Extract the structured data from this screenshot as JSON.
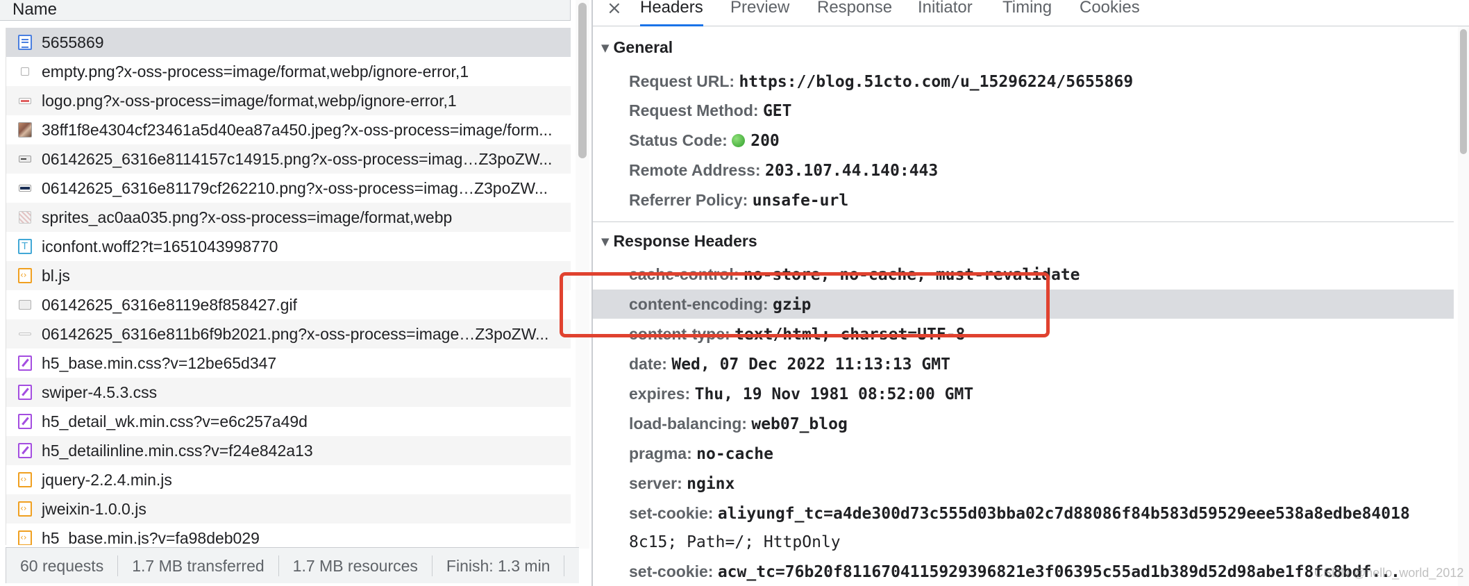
{
  "request_list": {
    "column_header": "Name",
    "rows": [
      {
        "name": "5655869",
        "icon": "document-icon"
      },
      {
        "name": "empty.png?x-oss-process=image/format,webp/ignore-error,1",
        "icon": "image-icon"
      },
      {
        "name": "logo.png?x-oss-process=image/format,webp/ignore-error,1",
        "icon": "image-icon"
      },
      {
        "name": "38ff1f8e4304cf23461a5d40ea87a450.jpeg?x-oss-process=image/form...",
        "icon": "image-icon"
      },
      {
        "name": "06142625_6316e8114157c14915.png?x-oss-process=imag…Z3poZW...",
        "icon": "image-icon"
      },
      {
        "name": "06142625_6316e81179cf262210.png?x-oss-process=imag…Z3poZW...",
        "icon": "image-icon"
      },
      {
        "name": "sprites_ac0aa035.png?x-oss-process=image/format,webp",
        "icon": "image-icon"
      },
      {
        "name": "iconfont.woff2?t=1651043998770",
        "icon": "font-icon"
      },
      {
        "name": "bl.js",
        "icon": "script-icon"
      },
      {
        "name": "06142625_6316e8119e8f858427.gif",
        "icon": "image-icon"
      },
      {
        "name": "06142625_6316e811b6f9b2021.png?x-oss-process=image…Z3poZW...",
        "icon": "image-icon"
      },
      {
        "name": "h5_base.min.css?v=12be65d347",
        "icon": "stylesheet-icon"
      },
      {
        "name": "swiper-4.5.3.css",
        "icon": "stylesheet-icon"
      },
      {
        "name": "h5_detail_wk.min.css?v=e6c257a49d",
        "icon": "stylesheet-icon"
      },
      {
        "name": "h5_detailinline.min.css?v=f24e842a13",
        "icon": "stylesheet-icon"
      },
      {
        "name": "jquery-2.2.4.min.js",
        "icon": "script-icon"
      },
      {
        "name": "jweixin-1.0.0.js",
        "icon": "script-icon"
      },
      {
        "name": "h5_base.min.js?v=fa98deb029",
        "icon": "script-icon"
      }
    ],
    "selected_index": 0
  },
  "status_bar": {
    "requests": "60 requests",
    "transferred": "1.7 MB transferred",
    "resources": "1.7 MB resources",
    "finish": "Finish: 1.3 min"
  },
  "detail_tabs": {
    "close_glyph": "×",
    "tabs": [
      "Headers",
      "Preview",
      "Response",
      "Initiator",
      "Timing",
      "Cookies"
    ],
    "active": "Headers"
  },
  "general": {
    "title": "General",
    "rows": [
      {
        "key": "Request URL:",
        "value": "https://blog.51cto.com/u_15296224/5655869"
      },
      {
        "key": "Request Method:",
        "value": "GET"
      },
      {
        "key": "Status Code:",
        "value": "200"
      },
      {
        "key": "Remote Address:",
        "value": "203.107.44.140:443"
      },
      {
        "key": "Referrer Policy:",
        "value": "unsafe-url"
      }
    ]
  },
  "response_headers": {
    "title": "Response Headers",
    "rows": [
      {
        "key": "cache-control:",
        "value": "no-store, no-cache, must-revalidate"
      },
      {
        "key": "content-encoding:",
        "value": "gzip"
      },
      {
        "key": "content-type:",
        "value": "text/html; charset=UTF-8"
      },
      {
        "key": "date:",
        "value": "Wed, 07 Dec 2022 11:13:13 GMT"
      },
      {
        "key": "expires:",
        "value": "Thu, 19 Nov 1981 08:52:00 GMT"
      },
      {
        "key": "load-balancing:",
        "value": "web07_blog"
      },
      {
        "key": "pragma:",
        "value": "no-cache"
      },
      {
        "key": "server:",
        "value": "nginx"
      },
      {
        "key": "set-cookie:",
        "value": "aliyungf_tc=a4de300d73c555d03bba02c7d88086f84b583d59529eee538a8edbe84018",
        "value_cont": "8c15; Path=/; HttpOnly"
      },
      {
        "key": "set-cookie:",
        "value": "acw_tc=76b20f8116704115929396821e3f06395c55ad1b389d52d98abe1f8fc8bdf..."
      }
    ],
    "highlighted_index": 1
  },
  "colors": {
    "annotation_box": "#e0422f",
    "active_tab_underline": "#1a73e8",
    "status_ok": "#2f9e2a"
  },
  "watermark": "CSDN @hello_world_2012"
}
